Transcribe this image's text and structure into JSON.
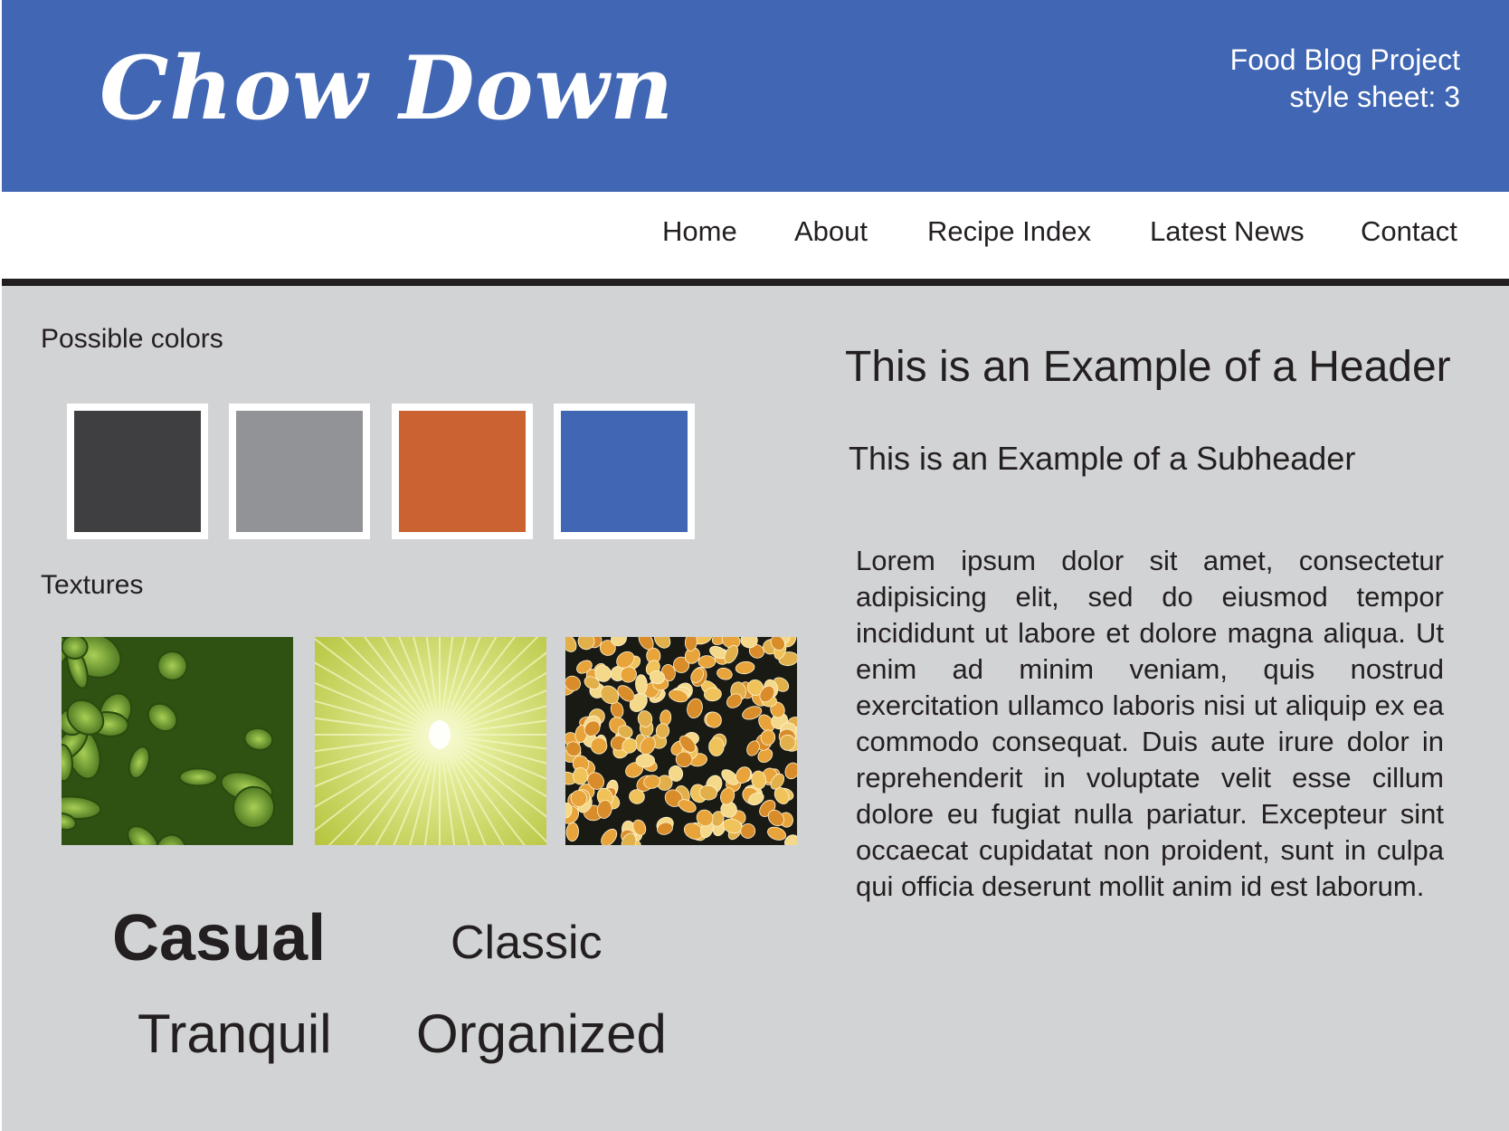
{
  "header": {
    "logo": "Chow Down",
    "project_line1": "Food Blog Project",
    "project_line2": "style sheet: 3",
    "background": "#4166b3"
  },
  "nav": {
    "items": [
      "Home",
      "About",
      "Recipe Index",
      "Latest News",
      "Contact"
    ]
  },
  "colors_section": {
    "label": "Possible colors",
    "swatches": [
      "#3f3f42",
      "#929397",
      "#cb6232",
      "#4166b3"
    ]
  },
  "textures_section": {
    "label": "Textures",
    "textures": [
      "lettuce-texture",
      "lime-texture",
      "corn-texture"
    ]
  },
  "mood_words": {
    "word1": "Casual",
    "word2": "Classic",
    "word3": "Tranquil",
    "word4": "Organized"
  },
  "typography": {
    "header": "This is an Example of a Header",
    "subheader": "This is an Example of a Subheader",
    "body": "Lorem ipsum dolor sit amet, consectetur adipisicing elit, sed do eiusmod tempor incididunt ut labore et dolore magna aliqua. Ut enim ad minim veniam, quis nostrud exercitation ullamco laboris nisi ut aliquip ex ea commodo consequat. Duis aute irure dolor in reprehenderit in voluptate velit esse cillum dolore eu fugiat nulla pariatur. Excepteur sint occaecat cupidatat non proident, sunt in culpa qui officia deserunt mollit anim id est laborum."
  }
}
